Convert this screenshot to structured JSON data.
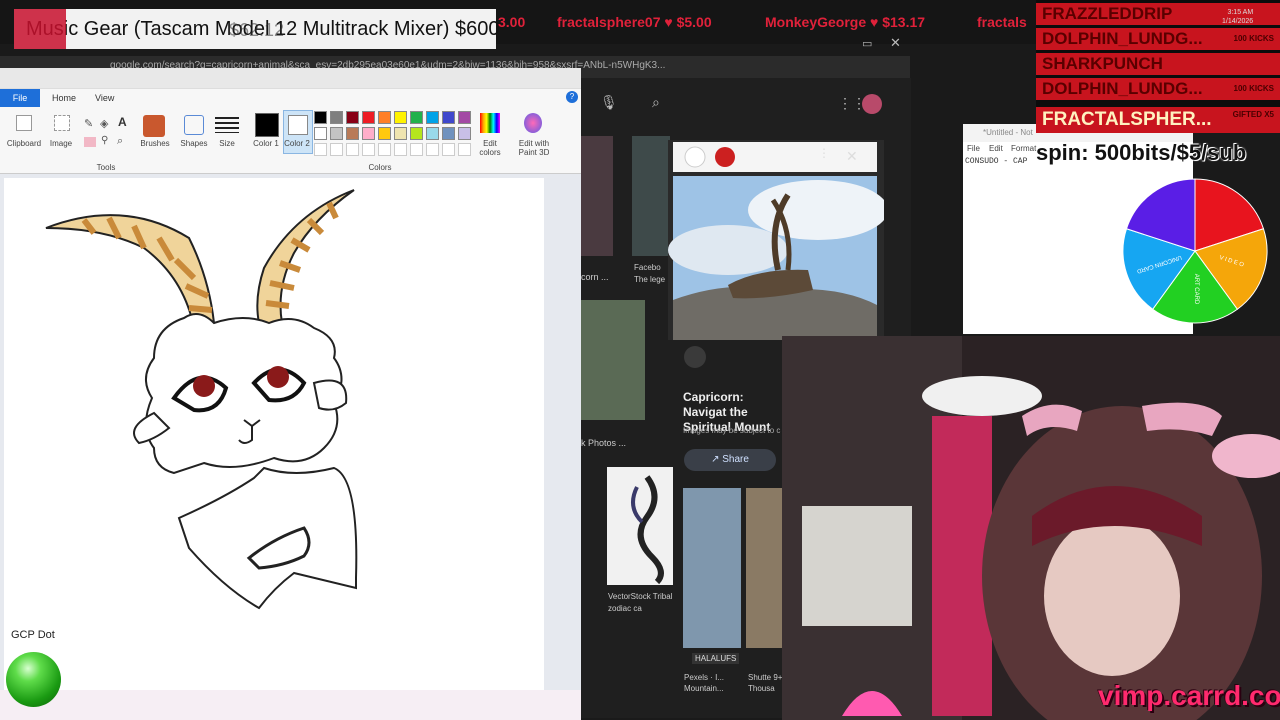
{
  "ticker": {
    "items": [
      {
        "text": "fractalsphere07 ♥ $5.00"
      },
      {
        "text": "MonkeyGeorge ♥ $13.17"
      },
      {
        "text": "fractals"
      },
      {
        "text": "3.00"
      }
    ],
    "gear_banner": "Music Gear (Tascam Model 12 Multitrack Mixer) $600",
    "gear_overlap": "$62.12"
  },
  "browser": {
    "url": "google.com/search?q=capricorn+animal&sca_esv=2db295ea03e60e1&udm=2&biw=1136&bih=958&sxsrf=ANbL-n5WHgK3...",
    "image_caption": "Capricorn: Navigat the Spiritual Mount",
    "image_sub": "Images may be subject to c",
    "share_label": "Share",
    "thumbs": [
      {
        "label": "corn ..."
      },
      {
        "label": "Facebo The lege"
      },
      {
        "label": "k Photos ..."
      },
      {
        "label": "VectorStock Tribal zodiac ca"
      },
      {
        "label": "Pexels · I... Mountain..."
      },
      {
        "label": "Shutte 9+ Thousa"
      },
      {
        "label": "HALALUFS"
      }
    ]
  },
  "paint": {
    "tabs": {
      "file": "File",
      "home": "Home",
      "view": "View"
    },
    "groups": {
      "clipboard": "Clipboard",
      "image": "Image",
      "tools": "Tools",
      "brushes": "Brushes",
      "shapes": "Shapes",
      "size": "Size",
      "color1": "Color 1",
      "color2": "Color 2",
      "colors": "Colors",
      "edit_colors": "Edit colors",
      "edit_paint3d": "Edit with Paint 3D"
    },
    "palette": [
      "#000000",
      "#7f7f7f",
      "#880015",
      "#ed1c24",
      "#ff7f27",
      "#fff200",
      "#22b14c",
      "#00a2e8",
      "#3f48cc",
      "#a349a4",
      "#ffffff",
      "#c3c3c3",
      "#b97a57",
      "#ffaec9",
      "#ffc90e",
      "#efe4b0",
      "#b5e61d",
      "#99d9ea",
      "#7092be",
      "#c8bfe7"
    ]
  },
  "notepad": {
    "title": "*Untitled - Not",
    "menu": [
      "File",
      "Edit",
      "Format"
    ],
    "content": "CONSUDO - CAP"
  },
  "subs": [
    {
      "name": "FRAZZLEDDRIP",
      "tag": ""
    },
    {
      "name": "DOLPHIN_LUNDG...",
      "tag": "100 KICKS"
    },
    {
      "name": "SHARKPUNCH",
      "tag": ""
    },
    {
      "name": "DOLPHIN_LUNDG...",
      "tag": "100 KICKS"
    },
    {
      "name": "FRACTALSPHER...",
      "tag": "GIFTED X5"
    }
  ],
  "spin_text": "spin: 500bits/$5/sub",
  "wheel": [
    {
      "label": "",
      "color": "#e8141e"
    },
    {
      "label": "V I D E O",
      "color": "#f5a60a"
    },
    {
      "label": "ART CARD",
      "color": "#22d022"
    },
    {
      "label": "UNICORN CARD",
      "color": "#16a6f2"
    },
    {
      "label": "",
      "color": "#5a1ee6"
    }
  ],
  "clock": {
    "time": "3:15 AM",
    "date": "1/14/2026"
  },
  "gcp": {
    "label": "GCP Dot"
  },
  "overlay": {
    "carrd": "vimp.carrd.co"
  }
}
